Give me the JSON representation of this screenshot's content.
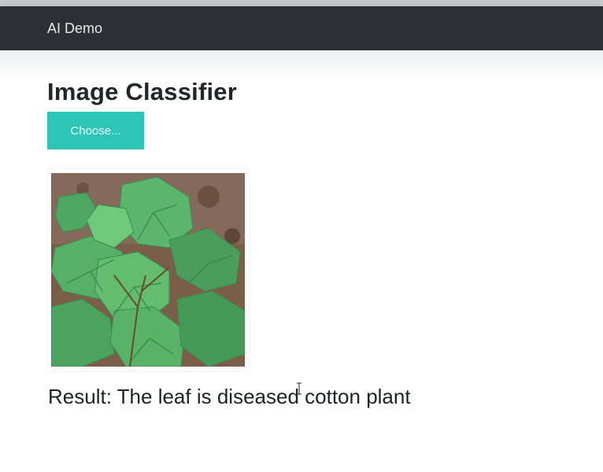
{
  "navbar": {
    "brand": "AI Demo"
  },
  "main": {
    "title": "Image Classifier",
    "choose_button_label": "Choose...",
    "result_text": "Result: The leaf is diseased cotton plant"
  },
  "colors": {
    "navbar_bg": "#2c3035",
    "button_bg": "#2ec4b6",
    "text": "#222628"
  },
  "icons": [
    "cotton-leaf-image",
    "text-cursor-icon"
  ]
}
